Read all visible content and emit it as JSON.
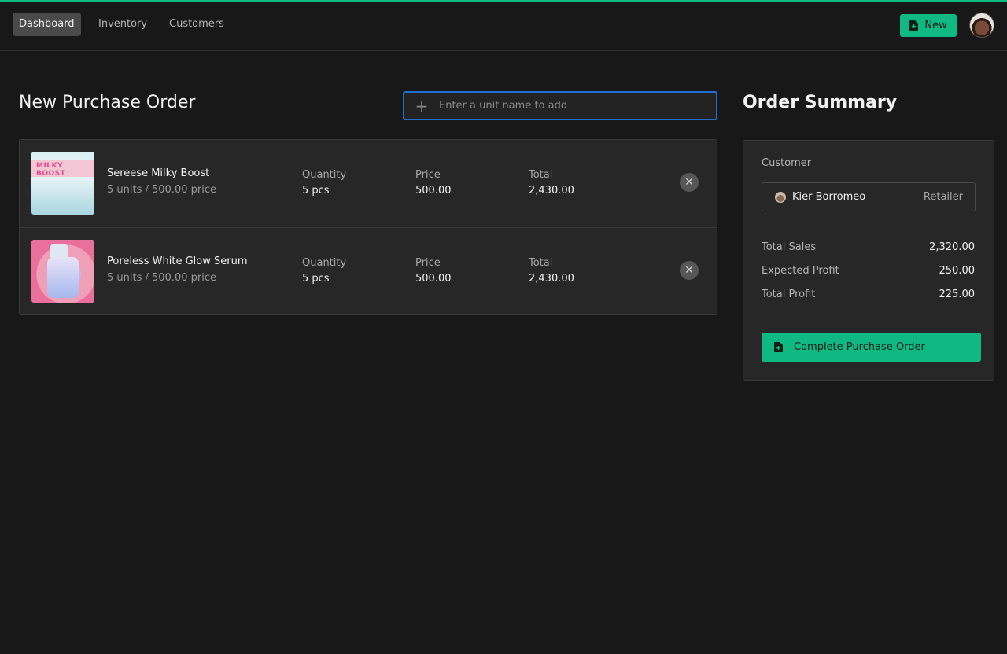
{
  "nav": {
    "items": [
      {
        "label": "Dashboard",
        "active": true
      },
      {
        "label": "Inventory",
        "active": false
      },
      {
        "label": "Customers",
        "active": false
      }
    ],
    "new_button": "New",
    "new_icon": "file-plus-icon",
    "avatar_icon": "user-avatar"
  },
  "accent_color": "#10b981",
  "page": {
    "title": "New Purchase Order",
    "search_placeholder": "Enter a unit name to add",
    "search_icon": "plus-icon"
  },
  "items": [
    {
      "name": "Sereese Milky Boost",
      "sub": "5 units / 500.00 price",
      "thumb_label": "MILKY BOOST",
      "quantity_label": "Quantity",
      "quantity": "5 pcs",
      "price_label": "Price",
      "price": "500.00",
      "total_label": "Total",
      "total": "2,430.00"
    },
    {
      "name": "Poreless White Glow Serum",
      "sub": "5 units / 500.00 price",
      "quantity_label": "Quantity",
      "quantity": "5 pcs",
      "price_label": "Price",
      "price": "500.00",
      "total_label": "Total",
      "total": "2,430.00"
    }
  ],
  "summary": {
    "title": "Order Summary",
    "customer_label": "Customer",
    "customer_name": "Kier Borromeo",
    "customer_type": "Retailer",
    "total_sales_label": "Total Sales",
    "total_sales": "2,320.00",
    "expected_profit_label": "Expected Profit",
    "expected_profit": "250.00",
    "total_profit_label": "Total Profit",
    "total_profit": "225.00",
    "complete_button": "Complete Purchase Order"
  }
}
